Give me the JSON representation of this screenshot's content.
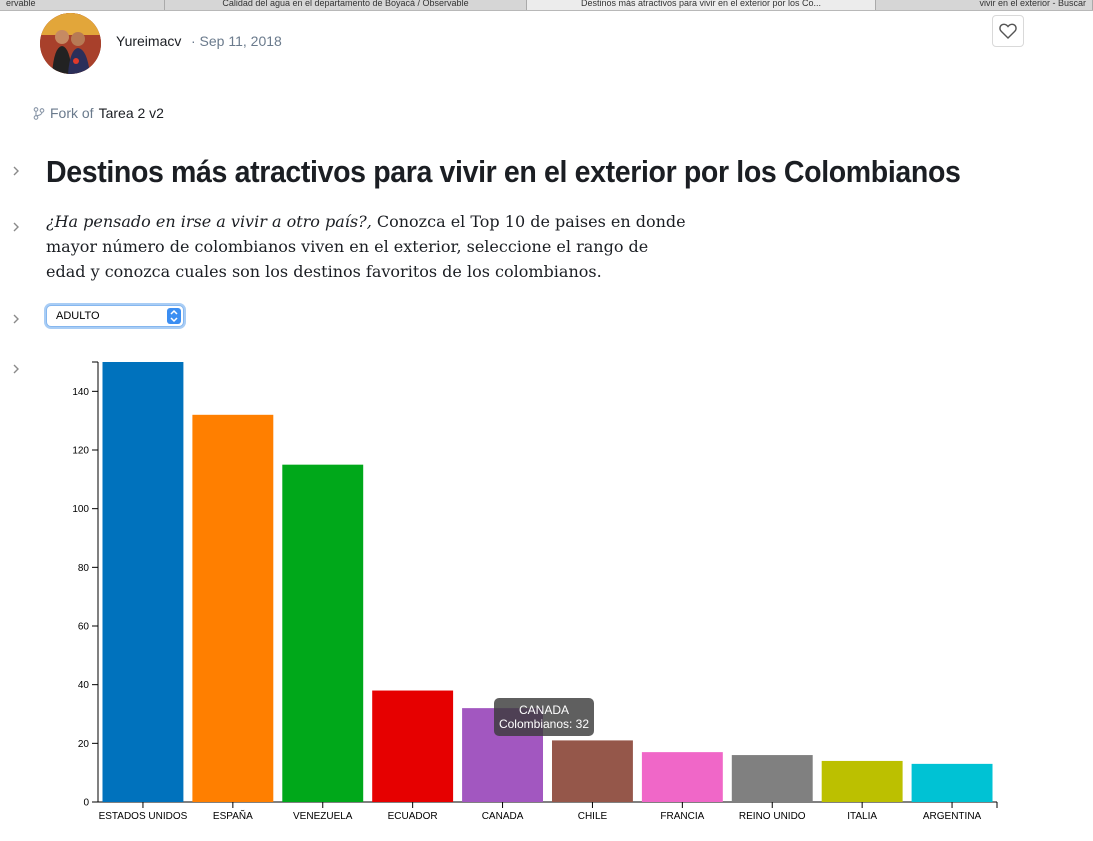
{
  "browser": {
    "tabs": [
      {
        "label": "ervable"
      },
      {
        "label": "Calidad del agua en el departamento de Boyacá / Observable"
      },
      {
        "label": "Destinos más atractivos para vivir en el exterior por los Co..."
      },
      {
        "label": "vivir en el exterior - Buscar"
      }
    ]
  },
  "header": {
    "author": "Yureimacv",
    "date": "· Sep 11, 2018",
    "fork_prefix": "Fork of",
    "fork_link": "Tarea 2 v2"
  },
  "main": {
    "title": "Destinos más atractivos para vivir en el exterior por los Colombianos",
    "intro_question": "¿Ha pensado en irse a vivir a otro país?,",
    "intro_text": " Conozca el Top 10 de paises en donde mayor número de colombianos viven en el exterior, seleccione el rango de edad y conozca cuales son los destinos favoritos de los colombianos.",
    "select_value": "ADULTO"
  },
  "tooltip": {
    "line1": "CANADA",
    "line2": "Colombianos: 32"
  },
  "icons": [
    "fork-icon",
    "heart-icon",
    "chevron-right-icon",
    "select-arrows-icon"
  ],
  "chart_data": {
    "type": "bar",
    "title": "",
    "xlabel": "",
    "ylabel": "",
    "ylim": [
      0,
      150
    ],
    "yticks": [
      "0",
      "20",
      "40",
      "60",
      "80",
      "100",
      "120",
      "140"
    ],
    "categories": [
      "ESTADOS UNIDOS",
      "ESPAÑA",
      "VENEZUELA",
      "ECUADOR",
      "CANADA",
      "CHILE",
      "FRANCIA",
      "REINO UNIDO",
      "ITALIA",
      "ARGENTINA"
    ],
    "values": [
      150,
      132,
      115,
      38,
      32,
      21,
      17,
      16,
      14,
      13
    ],
    "colors": [
      "#0072bd",
      "#ff7f00",
      "#00a81a",
      "#e60000",
      "#a257c0",
      "#95574a",
      "#f067c8",
      "#808080",
      "#bcc000",
      "#00c2d4"
    ],
    "grid": false
  }
}
